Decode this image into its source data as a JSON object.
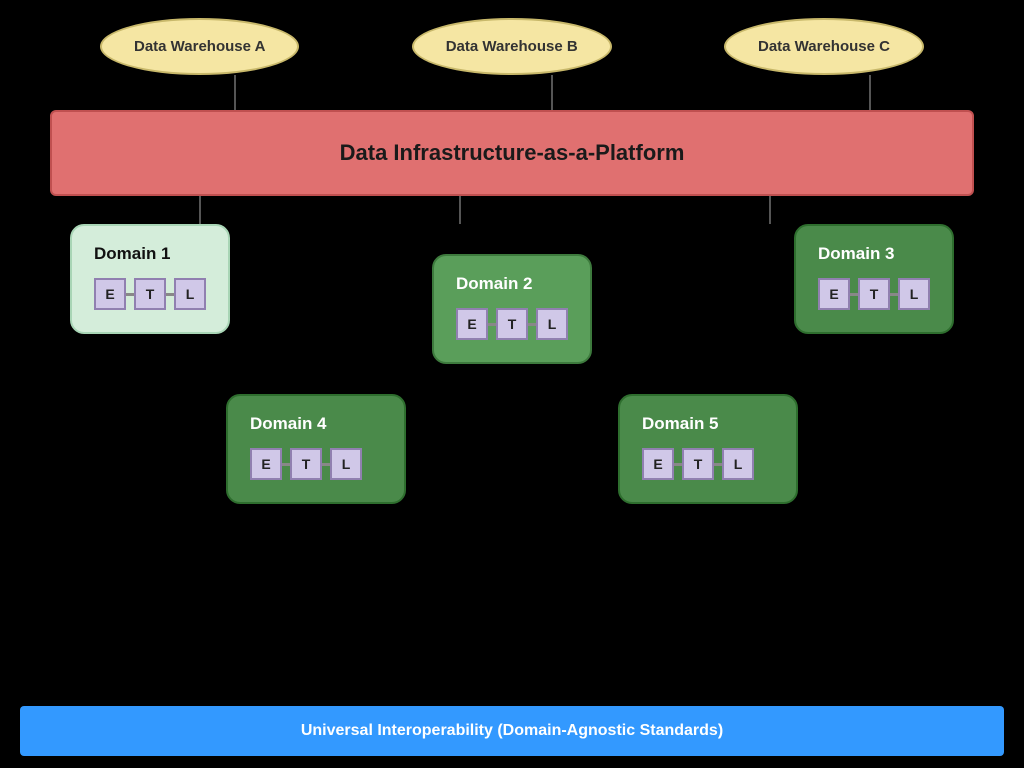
{
  "warehouses": [
    {
      "label": "Data Warehouse A",
      "id": "wh-a"
    },
    {
      "label": "Data Warehouse B",
      "id": "wh-b"
    },
    {
      "label": "Data Warehouse C",
      "id": "wh-c"
    }
  ],
  "platform": {
    "label": "Data Infrastructure-as-a-Platform"
  },
  "domains": [
    {
      "id": "d1",
      "label": "Domain 1",
      "color": "light-green",
      "etl": [
        "E",
        "T",
        "L"
      ]
    },
    {
      "id": "d2",
      "label": "Domain 2",
      "color": "medium-green",
      "etl": [
        "E",
        "T",
        "L"
      ]
    },
    {
      "id": "d3",
      "label": "Domain 3",
      "color": "dark-green",
      "etl": [
        "E",
        "T",
        "L"
      ]
    },
    {
      "id": "d4",
      "label": "Domain 4",
      "color": "dark-green",
      "etl": [
        "E",
        "T",
        "L"
      ]
    },
    {
      "id": "d5",
      "label": "Domain 5",
      "color": "dark-green",
      "etl": [
        "E",
        "T",
        "L"
      ]
    }
  ],
  "bottom_bar": {
    "label": "Universal Interoperability (Domain-Agnostic Standards)"
  }
}
